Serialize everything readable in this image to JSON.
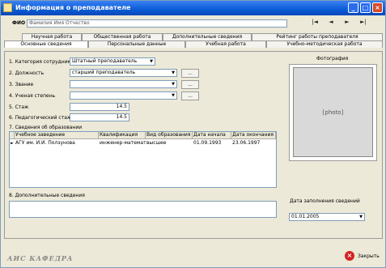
{
  "window": {
    "title": "Информация о преподавателе"
  },
  "toprow": {
    "label": "ФИО",
    "value": "Фамилия Имя Отчество"
  },
  "nav": {
    "first": "|◄",
    "prev": "◄",
    "next": "►",
    "last": "►|"
  },
  "tabs": {
    "row1": [
      "Научная работа",
      "Общественная работа",
      "Дополнительные сведения",
      "Рейтинг работы преподавателя"
    ],
    "row2": [
      "Основные сведения",
      "Персональные данные",
      "Учебная работа",
      "Учебно-методическая работа"
    ]
  },
  "form": {
    "category": {
      "label": "1. Категория сотрудника",
      "value": "Штатный преподаватель"
    },
    "position": {
      "label": "2. Должность",
      "value": "старший преподаватель"
    },
    "degree": {
      "label": "3. Звание",
      "value": ""
    },
    "rank": {
      "label": "4. Ученая степень",
      "value": ""
    },
    "experience": {
      "label": "5. Стаж",
      "value": "14.5"
    },
    "teaching_exp": {
      "label": "6. Педагогический стаж",
      "value": "14.5"
    },
    "education_title": "7. Сведения об образовании"
  },
  "education_table": {
    "headers": [
      "Учебное заведение",
      "Квалификация",
      "Вид образования",
      "Дата начала",
      "Дата окончания"
    ],
    "rows": [
      [
        "АГУ им. И.И. Ползунова",
        "инженер-математик",
        "высшее",
        "01.09.1993",
        "23.06.1997"
      ]
    ]
  },
  "memo": {
    "label": "8. Дополнительные сведения"
  },
  "photo": {
    "label": "Фотография"
  },
  "filldate": {
    "label": "Дата заполнения сведений",
    "value": "01.01.2005"
  },
  "footer": {
    "brand": "АИС КАФЕДРА",
    "close_label": "Закрыть"
  }
}
